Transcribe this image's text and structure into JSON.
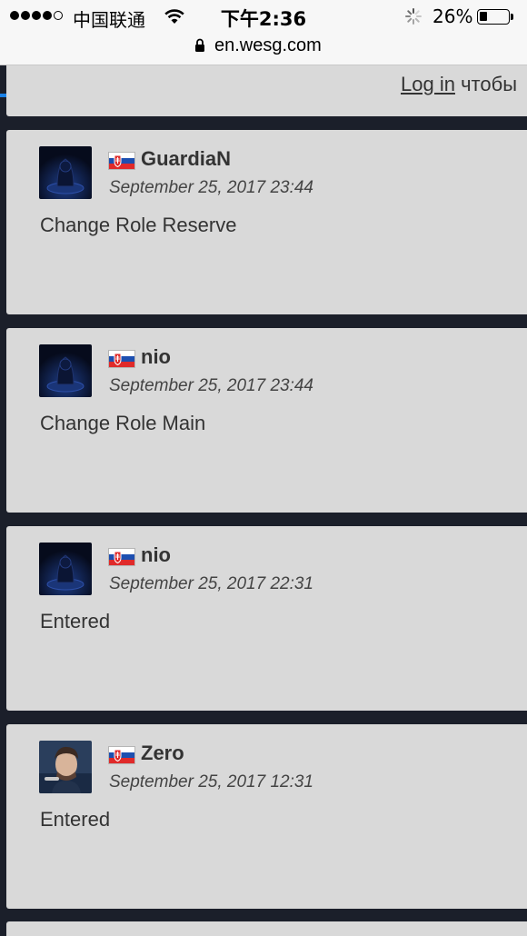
{
  "status_bar": {
    "carrier": "中国联通",
    "time": "下午2:36",
    "battery_percent": "26%",
    "battery_level": 0.26,
    "signal_bars": 4
  },
  "browser": {
    "url": "en.wesg.com",
    "load_progress": 0.29
  },
  "header": {
    "login_link": "Log in",
    "login_suffix": "чтобы"
  },
  "feed": [
    {
      "username": "GuardiaN",
      "timestamp": "September 25, 2017 23:44",
      "message": "Change Role Reserve",
      "flag": "slovakia",
      "avatar": "default-avatar"
    },
    {
      "username": "nio",
      "timestamp": "September 25, 2017 23:44",
      "message": "Change Role Main",
      "flag": "slovakia",
      "avatar": "default-avatar"
    },
    {
      "username": "nio",
      "timestamp": "September 25, 2017 22:31",
      "message": "Entered",
      "flag": "slovakia",
      "avatar": "default-avatar"
    },
    {
      "username": "Zero",
      "timestamp": "September 25, 2017 12:31",
      "message": "Entered",
      "flag": "slovakia",
      "avatar": "photo-avatar"
    }
  ],
  "colors": {
    "card_bg": "#d9d9d9",
    "page_bg": "#1b1f2a",
    "progress": "#1a82e8"
  }
}
